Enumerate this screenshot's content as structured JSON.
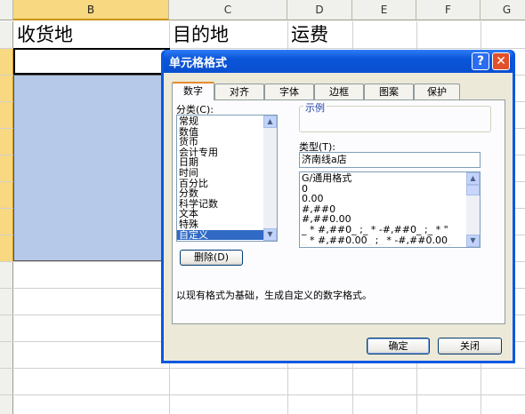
{
  "sheet": {
    "columns": [
      "B",
      "C",
      "D",
      "E",
      "F",
      "G"
    ],
    "headers": {
      "b": "收货地",
      "c": "目的地",
      "d": "运费"
    }
  },
  "dialog": {
    "title": "单元格格式",
    "help_btn": "?",
    "close_btn": "✕",
    "tabs": [
      "数字",
      "对齐",
      "字体",
      "边框",
      "图案",
      "保护"
    ],
    "category_label": "分类(C):",
    "categories": [
      "常规",
      "数值",
      "货币",
      "会计专用",
      "日期",
      "时间",
      "百分比",
      "分数",
      "科学记数",
      "文本",
      "特殊",
      "自定义"
    ],
    "selected_category": "自定义",
    "sample_label": "示例",
    "type_label": "类型(T):",
    "type_value": "济南线a店",
    "type_list": [
      "G/通用格式",
      "0",
      "0.00",
      "#,##0",
      "#,##0.00",
      "_ * #,##0_ ;_ * -#,##0_ ;_ * \"",
      "_ * #,##0.00_ ;_ * -#,##0.00_"
    ],
    "delete_btn": "删除(D)",
    "description": "以现有格式为基础，生成自定义的数字格式。",
    "ok_btn": "确定",
    "cancel_btn": "关闭"
  }
}
